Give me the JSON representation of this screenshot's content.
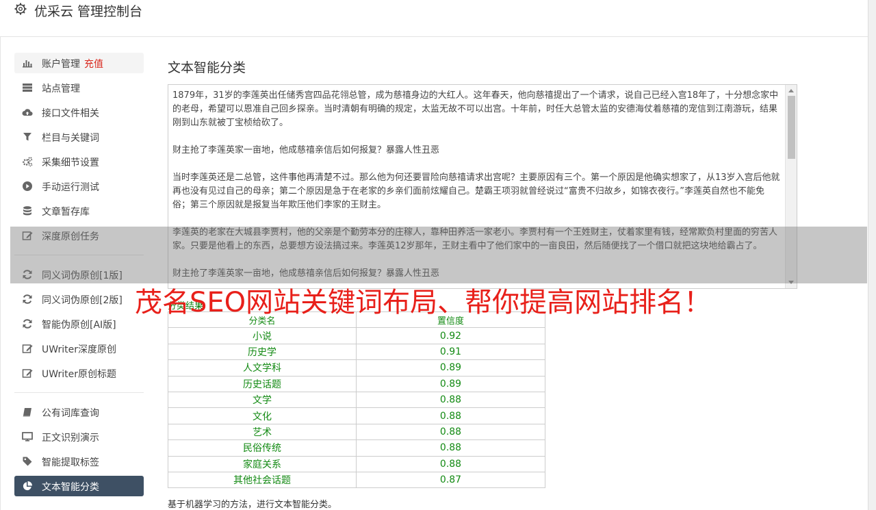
{
  "app": {
    "title": "优采云 管理控制台"
  },
  "sidebar": {
    "items": [
      {
        "label": "账户管理",
        "extra": "充值",
        "icon": "bar-chart-icon"
      },
      {
        "label": "站点管理",
        "icon": "server-icon"
      },
      {
        "label": "接口文件相关",
        "icon": "cloud-upload-icon"
      },
      {
        "label": "栏目与关键词",
        "icon": "filter-icon"
      },
      {
        "label": "采集细节设置",
        "icon": "gears-icon"
      },
      {
        "label": "手动运行测试",
        "icon": "play-circle-icon"
      },
      {
        "label": "文章暂存库",
        "icon": "database-icon"
      },
      {
        "label": "深度原创任务",
        "icon": "edit-icon"
      },
      {
        "label": "同义词伪原创[1版]",
        "icon": "refresh-icon"
      },
      {
        "label": "同义词伪原创[2版]",
        "icon": "refresh-icon"
      },
      {
        "label": "智能伪原创[AI版]",
        "icon": "refresh-icon"
      },
      {
        "label": "UWriter深度原创",
        "icon": "edit-icon"
      },
      {
        "label": "UWriter原创标题",
        "icon": "edit-icon"
      },
      {
        "label": "公有词库查询",
        "icon": "book-icon"
      },
      {
        "label": "正文识别演示",
        "icon": "monitor-icon"
      },
      {
        "label": "智能提取标签",
        "icon": "tag-icon"
      },
      {
        "label": "文本智能分类",
        "icon": "pie-chart-icon"
      }
    ]
  },
  "main": {
    "title": "文本智能分类",
    "text_paragraphs": [
      "1879年，31岁的李莲英出任储秀宫四品花翎总管，成为慈禧身边的大红人。这年春天，他向慈禧提出了一个请求，说自己已经入宫18年了，十分想念家中的老母，希望可以恩准自己回乡探亲。当时清朝有明确的规定，太监无故不可以出宫。十年前，时任大总管太监的安德海仗着慈禧的宠信到江南游玩，结果刚到山东就被丁宝桢给砍了。",
      "财主抢了李莲英家一亩地，他成慈禧亲信后如何报复？暴露人性丑恶",
      "当时李莲英还是二总管，这件事他再清楚不过。那么他为何还要冒险向慈禧请求出宫呢？主要原因有三个。第一个原因是他确实想家了，从13岁入宫后他就再也没有见过自己的母亲；第二个原因是急于在老家的乡亲们面前炫耀自己。楚霸王项羽就曾经说过“富贵不归故乡，如锦衣夜行。”李莲英自然也不能免俗；第三个原因就是报复当年欺压他们李家的王财主。",
      "李莲英的老家在大城县李贾村，他的父亲是个勤劳本分的庄稼人，靠种田养活一家老小。李贾村有一个王姓财主，仗着家里有钱，经常欺负村里面的穷苦人家。只要是他看上的东西，总要想方设法搞过来。李莲英12岁那年，王财主看中了他们家中的一亩良田，然后随便找了一个借口就把这块地给霸占了。",
      "财主抢了李莲英家一亩地，他成慈禧亲信后如何报复？暴露人性丑恶"
    ],
    "result_label": "分类结果",
    "table": {
      "headers": [
        "分类名",
        "置信度"
      ],
      "rows": [
        [
          "小说",
          "0.92"
        ],
        [
          "历史学",
          "0.91"
        ],
        [
          "人文学科",
          "0.89"
        ],
        [
          "历史话题",
          "0.89"
        ],
        [
          "文学",
          "0.88"
        ],
        [
          "文化",
          "0.88"
        ],
        [
          "艺术",
          "0.88"
        ],
        [
          "民俗传统",
          "0.88"
        ],
        [
          "家庭关系",
          "0.88"
        ],
        [
          "其他社会话题",
          "0.87"
        ]
      ]
    },
    "description": "基于机器学习的方法，进行文本智能分类。"
  },
  "overlay": {
    "watermark": "茂名SEO网站关键词布局、帮你提高网站排名！"
  },
  "colors": {
    "accent": "#d9261c",
    "active_nav": "#3e5064",
    "result_green": "#138a13",
    "watermark": "#e8201a"
  }
}
